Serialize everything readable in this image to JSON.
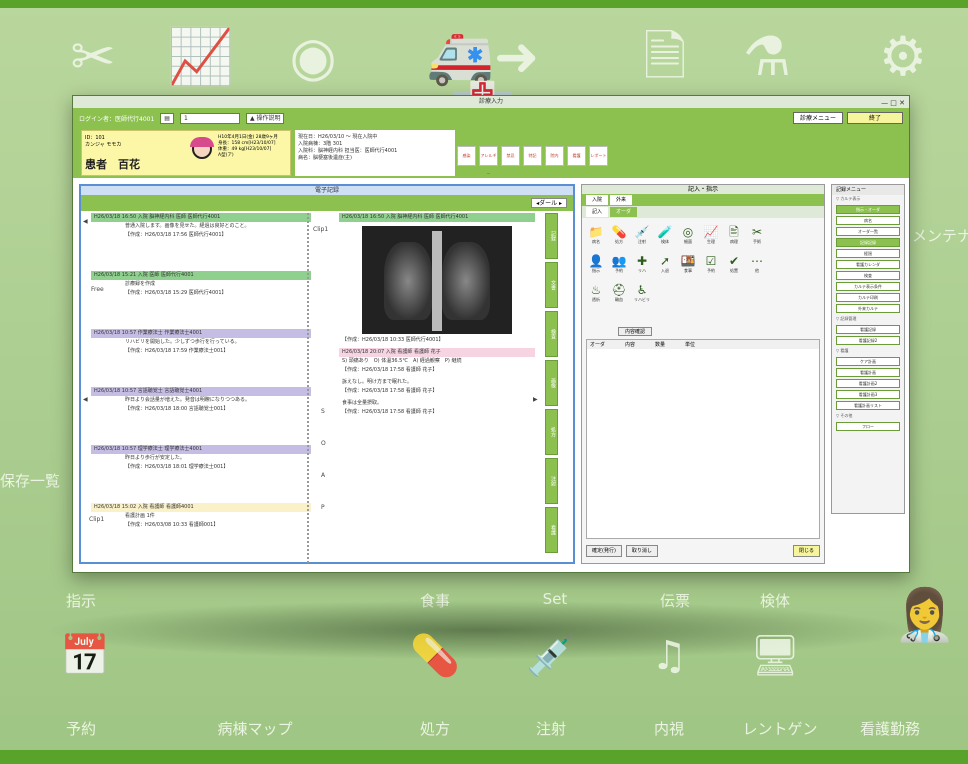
{
  "background": {
    "top_labels": [
      "指示",
      "食事",
      "Set",
      "伝票",
      "検体"
    ],
    "bottom_labels": [
      "予約",
      "病棟マップ",
      "処方",
      "注射",
      "内視",
      "レントゲン",
      "看護勤務"
    ],
    "side_left": "保存一覧",
    "side_right": "メンテナ",
    "accent_color": "#5aa32b"
  },
  "window": {
    "title": "診療入力",
    "controls": "— □ ✕",
    "toolbar": {
      "login": "ログイン者：医師代行4001",
      "field": "1",
      "manual_btn": "▲ 操作説明",
      "menu_btn": "診療メニュー",
      "close_btn": "終了"
    },
    "patient": {
      "id": "ID：101",
      "kana": "カンジャ モモカ",
      "name": "患者　百花",
      "dob": "H10年4月1日(金) 28歳9ヶ月",
      "height": "身長：158 cm[H23/10/07]",
      "weight": "体重：49 kg[H23/10/07]",
      "blood": "A型(ア)"
    },
    "info": {
      "line1": "現在日：H26/03/10 ～ 現在入院中",
      "line2": "入院病棟：3階 301",
      "line3": "入院科：脳神経内科 担当医：医師代行4001",
      "line4": "病名：脳梗塞後遺症(主)"
    },
    "action_buttons": [
      "感染",
      "アレルギー",
      "禁忌",
      "特記",
      "院内",
      "看護",
      "レポート"
    ]
  },
  "records": {
    "header": "電子記録",
    "filter_btn": "◂ダール ▸",
    "left_label": "Free",
    "clip_label": "Clip1",
    "left_entries": [
      {
        "head": "H26/03/18 16:50 入院 脳神経内科 医師 医師代行4001",
        "text": "普通入院します。画像を見せた。経過は良好とのこと。",
        "foot": "【作成：H26/03/18 17:56 医師代行4001】",
        "color": "eg"
      },
      {
        "head": "H26/03/18 15:21 入院 医師 医師代行4001",
        "text": "診療録を作成",
        "foot": "【作成：H26/03/18 15:29 医師代行4001】",
        "color": "eg"
      },
      {
        "head": "H26/03/18 10:57 作業療法士 作業療法士4001",
        "text": "リハビリを開始した。少しずつ歩行を行っている。",
        "foot": "【作成：H26/03/18 17:59 作業療法士001】",
        "color": "ep"
      },
      {
        "head": "H26/03/18 10:57 言語聴覚士 言語聴覚士4001",
        "text": "昨日より会話量が増えた。発音は明瞭になりつつある。",
        "foot": "【作成：H26/03/18 18:00 言語聴覚士001】",
        "color": "ep"
      },
      {
        "head": "H26/03/18 10:57 理学療法士 理学療法士4001",
        "text": "昨日より歩行が安定した。",
        "foot": "【作成：H26/03/18 18:01 理学療法士001】",
        "color": "ep"
      },
      {
        "head": "H26/03/18 15:02 入院 看護師 看護師4001",
        "text": "看護計画 1件",
        "foot": "【作成：H26/03/08 10:33 看護師001】",
        "color": "ey"
      }
    ],
    "right_entries": [
      {
        "head": "H26/03/18 16:50 入院 脳神経内科 医師 医師代行4001",
        "text": "",
        "foot": "【作成：H26/03/18 10:33 医師代行4001】",
        "color": "eg"
      },
      {
        "head": "H26/03/18 20:07 入院 看護師 看護師 花子",
        "text": "S) 頭痛あり　O) 体温36.5℃　A) 経過観察　P) 継続",
        "foot": "【作成：H26/03/18 17:58 看護師 花子】",
        "color": "epink"
      },
      {
        "head": "",
        "text": "訴えなし。明け方まで眠れた。",
        "foot": "【作成：H26/03/18 17:58 看護師 花子】",
        "color": "ey"
      },
      {
        "head": "",
        "text": "食事は全量摂取。",
        "foot": "【作成：H26/03/18 17:58 看護師 花子】",
        "color": "ey"
      }
    ],
    "soap": [
      "S",
      "O",
      "A",
      "P"
    ],
    "vtabs": [
      "記録",
      "文書",
      "検査",
      "画像",
      "処方",
      "注射",
      "看護"
    ]
  },
  "orders": {
    "header": "記入・指示",
    "tabs": [
      "入院",
      "外来"
    ],
    "subtabs": [
      "記入",
      "オーダ"
    ],
    "icons": [
      {
        "glyph": "📁",
        "label": "病名"
      },
      {
        "glyph": "💊",
        "label": "処方"
      },
      {
        "glyph": "💉",
        "label": "注射"
      },
      {
        "glyph": "🧪",
        "label": "検体"
      },
      {
        "glyph": "◎",
        "label": "細菌"
      },
      {
        "glyph": "📈",
        "label": "生理"
      },
      {
        "glyph": "🖹",
        "label": "病理"
      },
      {
        "glyph": "✂",
        "label": "手術"
      },
      {
        "glyph": "👤",
        "label": "指示"
      },
      {
        "glyph": "👥",
        "label": "予約"
      },
      {
        "glyph": "✚",
        "label": "リハ"
      },
      {
        "glyph": "➚",
        "label": "入退"
      },
      {
        "glyph": "🍱",
        "label": "食事"
      },
      {
        "glyph": "☑",
        "label": "予約"
      },
      {
        "glyph": "✔",
        "label": "処置"
      },
      {
        "glyph": "⋯",
        "label": "他"
      },
      {
        "glyph": "♨",
        "label": "透析"
      },
      {
        "glyph": "⛑",
        "label": "輸血"
      },
      {
        "glyph": "♿",
        "label": "リハビリ"
      }
    ],
    "history_btn": "内容確認",
    "list_cols": [
      "オーダ",
      "内容",
      "数量",
      "単位"
    ],
    "footer": {
      "save": "確定(発行)",
      "clear": "取り消し",
      "close": "閉じる"
    }
  },
  "menu": {
    "header": "記録メニュー",
    "groups": [
      {
        "title": "▽ カルテ表示",
        "items": [
          "指示・オーダ",
          "病名",
          "オーダ一覧",
          "記録記録",
          "経過",
          "看護カレンダ",
          "検査",
          "カルテ表示条件",
          "カルテ印刷",
          "外来カルテ"
        ]
      },
      {
        "title": "▽ 記録管理",
        "items": [
          "看護記録",
          "看護記録2"
        ]
      },
      {
        "title": "▽ 看護",
        "items": [
          "ケア計画",
          "看護計画",
          "看護計画2",
          "看護計画3",
          "看護計画リスト"
        ]
      },
      {
        "title": "▽ その他",
        "items": [
          "フロー"
        ]
      }
    ]
  }
}
